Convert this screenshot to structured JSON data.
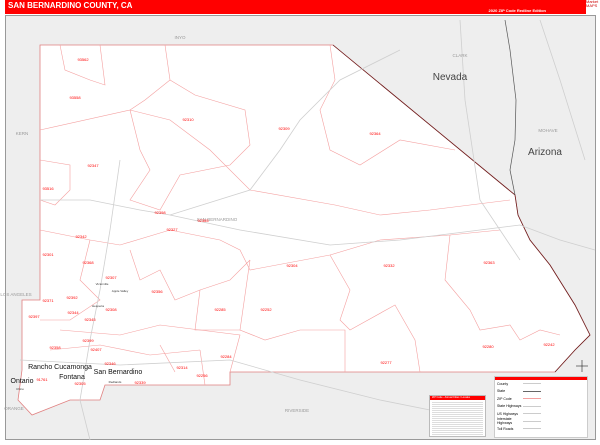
{
  "header": {
    "title": "SAN BERNARDINO COUNTY, CA",
    "edition": "2020 ZIP Code Redline Edition",
    "logo": "Market MAPS"
  },
  "states": [
    "Nevada",
    "Arizona"
  ],
  "regions": [
    "INYO",
    "KERN",
    "CLARK",
    "MOHAVE",
    "SAN BERNARDINO",
    "LOS ANGELES",
    "RIVERSIDE",
    "ORANGE"
  ],
  "cities": [
    "Victorville",
    "Apple Valley",
    "Hesperia",
    "Rancho Cucamonga",
    "Fontana",
    "San Bernardino",
    "Ontario",
    "Chino",
    "Redlands"
  ],
  "zips": [
    "93562",
    "93558",
    "92310",
    "92309",
    "92364",
    "92347",
    "93516",
    "92342",
    "92398",
    "92365",
    "92327",
    "92301",
    "92368",
    "92307",
    "92356",
    "92285",
    "92252",
    "92304",
    "92332",
    "92363",
    "92371",
    "92392",
    "92344",
    "92345",
    "92308",
    "92397",
    "92358",
    "92284",
    "92346",
    "92314",
    "92256",
    "92339",
    "92277",
    "92280",
    "92242",
    "92407",
    "91761",
    "92399",
    "92305"
  ],
  "legend": {
    "items": [
      "County",
      "State",
      "ZIP Code",
      "State Highways",
      "US Highways",
      "Interstate Highways",
      "Toll Roads"
    ]
  },
  "index": {
    "title": "ZIP Code - Annual Cities / Locales"
  },
  "colors": {
    "brand": "#ff0000",
    "zip_line": "#f4a0a0",
    "state_line": "#6b2020",
    "outside": "#eeeeee"
  }
}
